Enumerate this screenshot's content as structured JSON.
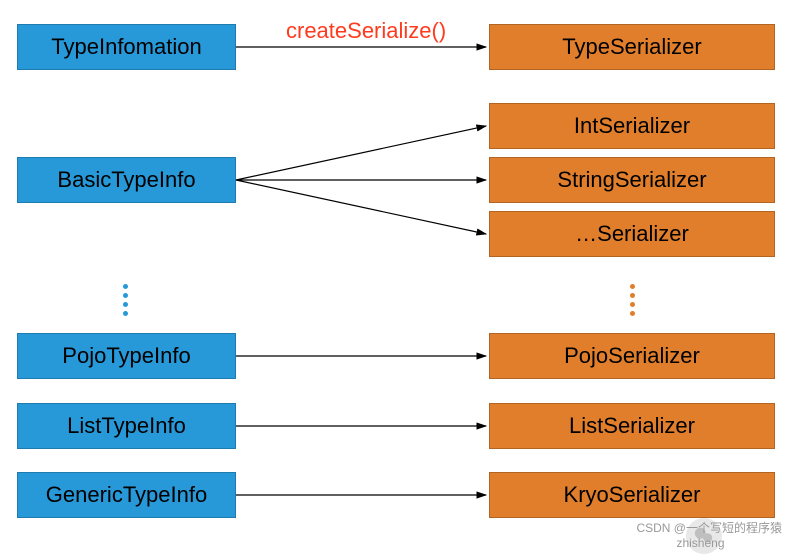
{
  "method_label": "createSerialize()",
  "left": {
    "type_info": "TypeInfomation",
    "basic": "BasicTypeInfo",
    "pojo": "PojoTypeInfo",
    "list": "ListTypeInfo",
    "generic": "GenericTypeInfo"
  },
  "right": {
    "type_ser": "TypeSerializer",
    "int_ser": "IntSerializer",
    "string_ser": "StringSerializer",
    "etc_ser": "…Serializer",
    "pojo_ser": "PojoSerializer",
    "list_ser": "ListSerializer",
    "kryo_ser": "KryoSerializer"
  },
  "watermark": {
    "csdn": "CSDN @一个写短的程序猿",
    "wechat": "zhisheng"
  },
  "colors": {
    "blue": "#2799d9",
    "orange": "#e07e2c",
    "method": "#ff3b1f"
  }
}
